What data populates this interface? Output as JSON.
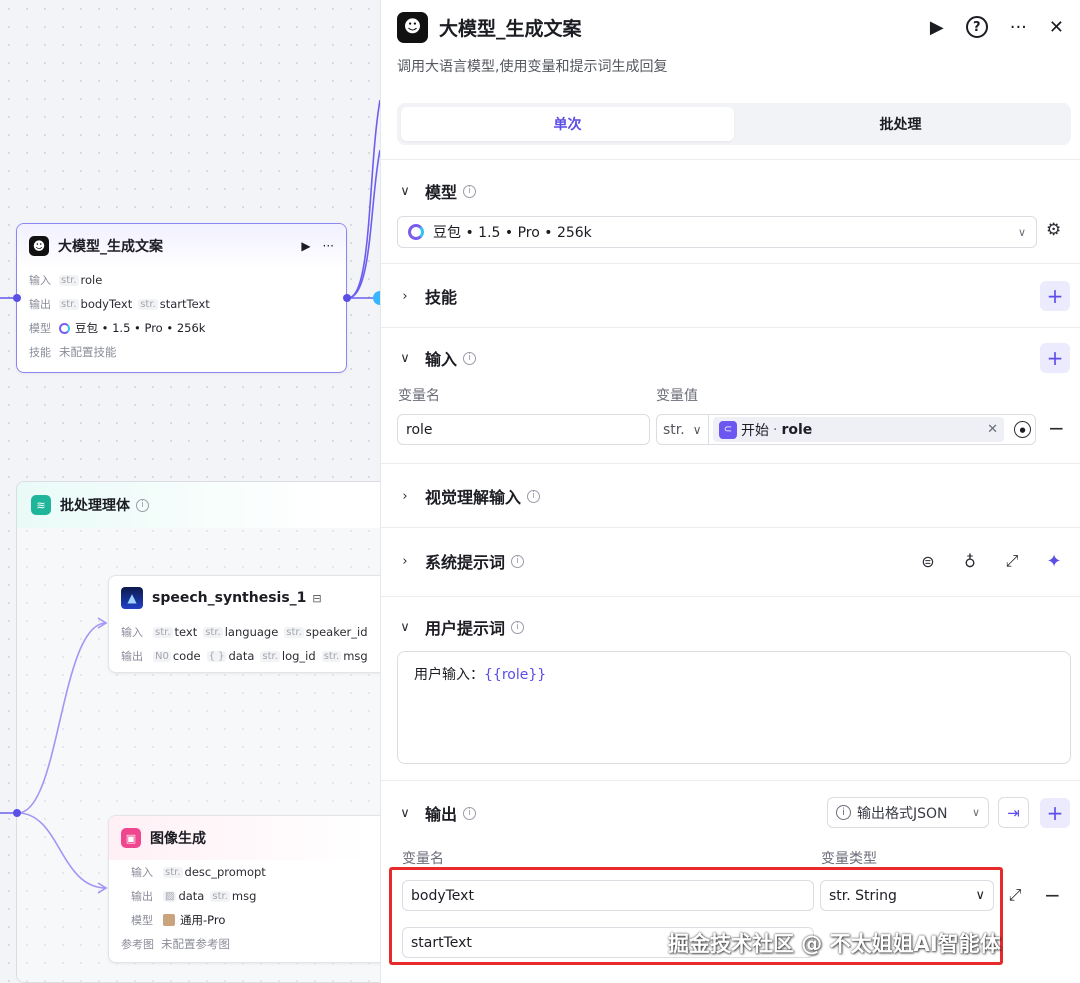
{
  "canvas": {
    "llm_node": {
      "title": "大模型_生成文案",
      "input_label": "输入",
      "output_label": "输出",
      "model_label": "模型",
      "skill_label": "技能",
      "inputs": [
        {
          "type": "str.",
          "name": "role"
        }
      ],
      "outputs": [
        {
          "type": "str.",
          "name": "bodyText"
        },
        {
          "type": "str.",
          "name": "startText"
        }
      ],
      "model": "豆包 • 1.5 • Pro • 256k",
      "skill": "未配置技能"
    },
    "batch": {
      "title": "批处理理体"
    },
    "speech_node": {
      "title": "speech_synthesis_1",
      "input_label": "输入",
      "output_label": "输出",
      "inputs": [
        {
          "type": "str.",
          "name": "text"
        },
        {
          "type": "str.",
          "name": "language"
        },
        {
          "type": "str.",
          "name": "speaker_id"
        }
      ],
      "outputs": [
        {
          "type": "N0",
          "name": "code"
        },
        {
          "type": "{ }",
          "name": "data"
        },
        {
          "type": "str.",
          "name": "log_id"
        },
        {
          "type": "str.",
          "name": "msg"
        }
      ]
    },
    "image_node": {
      "title": "图像生成",
      "input_label": "输入",
      "output_label": "输出",
      "model_label": "模型",
      "ref_label": "参考图",
      "inputs": [
        {
          "type": "str.",
          "name": "desc_promopt"
        }
      ],
      "outputs": [
        {
          "type": "img",
          "name": "data"
        },
        {
          "type": "str.",
          "name": "msg"
        }
      ],
      "model": "通用-Pro",
      "ref": "未配置参考图"
    }
  },
  "panel": {
    "title": "大模型_生成文案",
    "description": "调用大语言模型,使用变量和提示词生成回复",
    "tabs": [
      {
        "label": "单次"
      },
      {
        "label": "批处理"
      }
    ],
    "sections": {
      "model": "模型",
      "skills": "技能",
      "input": "输入",
      "vision": "视觉理解输入",
      "system_prompt": "系统提示词",
      "user_prompt": "用户提示词",
      "output": "输出"
    },
    "model_value": "豆包 • 1.5 • Pro • 256k",
    "input": {
      "var_name_label": "变量名",
      "var_value_label": "变量值",
      "row": {
        "name": "role",
        "type": "str.",
        "ref_source": "开始",
        "ref_sep": "·",
        "ref_var": "role"
      }
    },
    "user_prompt": {
      "prefix": "用户输入：",
      "variable": "{{role}}"
    },
    "output": {
      "format_label": "输出格式JSON",
      "var_name_label": "变量名",
      "var_type_label": "变量类型",
      "rows": [
        {
          "name": "bodyText",
          "type": "str. String"
        },
        {
          "name": "startText"
        }
      ]
    }
  },
  "watermark": "掘金技术社区 @ 不太姐姐AI智能体",
  "colors": {
    "accent": "#5b4de6",
    "highlight": "#e82a2a"
  }
}
